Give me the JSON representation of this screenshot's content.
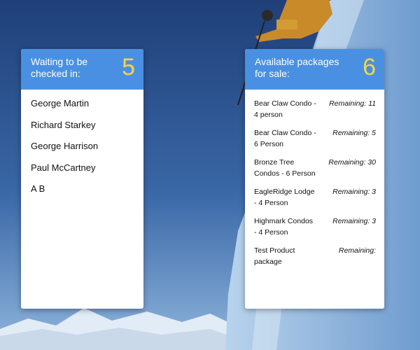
{
  "checkin": {
    "title": "Waiting to be checked in:",
    "count": "5",
    "names": [
      "George Martin",
      "Richard Starkey",
      "George Harrison",
      "Paul McCartney",
      "A B"
    ]
  },
  "packages": {
    "title": "Available packages for sale:",
    "count": "6",
    "items": [
      {
        "name": "Bear Claw Condo - 4 person",
        "remaining": "Remaining: 11"
      },
      {
        "name": "Bear Claw Condo - 6 Person",
        "remaining": "Remaining: 5"
      },
      {
        "name": "Bronze Tree Condos - 6 Person",
        "remaining": "Remaining: 30"
      },
      {
        "name": "EagleRidge Lodge - 4 Person",
        "remaining": "Remaining: 3"
      },
      {
        "name": "Highmark Condos - 4 Person",
        "remaining": "Remaining: 3"
      },
      {
        "name": "Test Product package",
        "remaining": "Remaining:"
      }
    ]
  },
  "colors": {
    "accent": "#4a90e2",
    "count": "#f2d642"
  }
}
